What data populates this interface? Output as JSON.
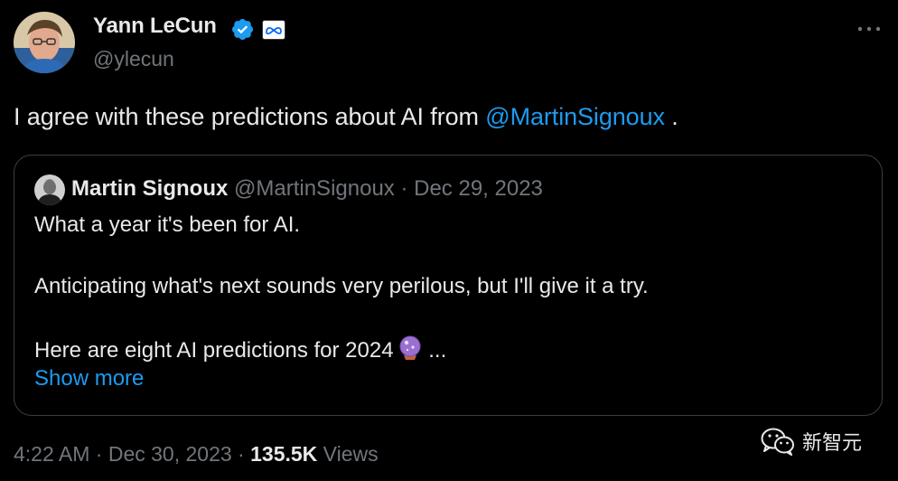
{
  "author": {
    "display_name": "Yann LeCun",
    "handle": "@ylecun",
    "verified_icon": "verified-check-icon",
    "affiliation_icon": "meta-logo-icon"
  },
  "menu": {
    "icon": "more-dots-icon"
  },
  "tweet": {
    "text_before": "I agree with these predictions about AI from ",
    "mention": "@MartinSignoux",
    "text_after": " ."
  },
  "quote": {
    "author_name": "Martin Signoux",
    "author_handle": "@MartinSignoux",
    "separator": " · ",
    "date": "Dec 29, 2023",
    "lines": [
      "What a year it's been for AI.",
      "Anticipating what's next sounds very perilous, but I'll give it a try.",
      "Here are eight AI predictions for 2024"
    ],
    "ellipsis": " ...",
    "emoji_icon": "crystal-ball-icon",
    "show_more": "Show more"
  },
  "footer": {
    "time": "4:22 AM",
    "sep1": " · ",
    "date": "Dec 30, 2023",
    "sep2": " · ",
    "views_count": "135.5K",
    "views_label": " Views"
  },
  "watermark": {
    "text": "新智元",
    "icon": "wechat-logo-icon"
  },
  "colors": {
    "background": "#000000",
    "text_primary": "#e7e9ea",
    "text_secondary": "#71767b",
    "accent": "#1d9bf0",
    "border": "#3a3f44"
  }
}
